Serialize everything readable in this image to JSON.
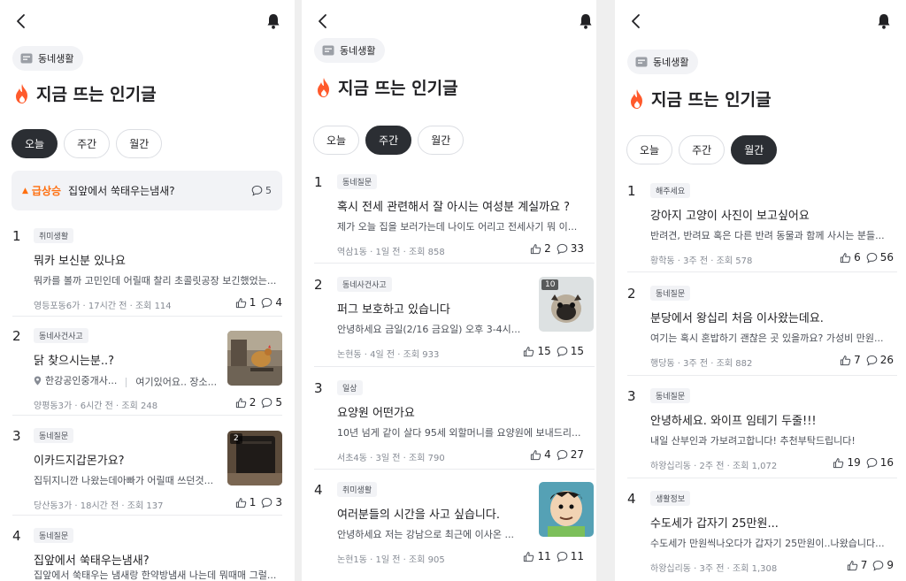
{
  "panels": [
    {
      "chip": "동네생활",
      "title": "지금 뜨는 인기글",
      "tabs": [
        "오늘",
        "주간",
        "월간"
      ],
      "active_tab": "오늘",
      "trending": {
        "label": "급상승",
        "text": "집앞에서 쑥태우는냄새?",
        "comments": "5"
      },
      "posts": [
        {
          "rank": "1",
          "category": "취미생활",
          "title": "뭐카 보신분 있나요",
          "body": "뭐카를 볼까 고민인데 어릴때 찰리 초콜릿공장 보긴했었는...",
          "area": "영등포동6가",
          "time": "17시간 전",
          "views": "조회 114",
          "likes": "1",
          "comments": "4"
        },
        {
          "rank": "2",
          "category": "동네사건사고",
          "title": "닭 찾으시는분..?",
          "location": "한강공인중개사...",
          "body": "여기있어요.. 장소...",
          "area": "양평동3가",
          "time": "6시간 전",
          "views": "조회 248",
          "likes": "2",
          "comments": "5"
        },
        {
          "rank": "3",
          "category": "동네질문",
          "title": "이카드지갑몬가요?",
          "body": "집뒤지니깐 나왔는데아빠가 어릴때 쓰던것...",
          "area": "당산동3가",
          "time": "18시간 전",
          "views": "조회 137",
          "likes": "1",
          "comments": "3",
          "image_count": "2"
        },
        {
          "rank": "4",
          "category": "동네질문",
          "title": "집앞에서 쑥태우는냄새?",
          "body": "집앞에서 쑥태우는 냄새랑 한약방냄새 나는데 뭐때매 그럴..."
        }
      ]
    },
    {
      "chip": "동네생활",
      "title": "지금 뜨는 인기글",
      "tabs": [
        "오늘",
        "주간",
        "월간"
      ],
      "active_tab": "주간",
      "posts": [
        {
          "rank": "1",
          "category": "동네질문",
          "title": "혹시 전세 관련해서 잘 아시는 여성분 계실까요 ?",
          "body": "제가 오늘 집을 보러가는데 나이도 어리고 전세사기 뭐 이...",
          "area": "역삼1동",
          "time": "1일 전",
          "views": "조회 858",
          "likes": "2",
          "comments": "33"
        },
        {
          "rank": "2",
          "category": "동네사건사고",
          "title": "퍼그 보호하고 있습니다",
          "body": "안녕하세요 금일(2/16 금요일) 오후 3-4시...",
          "area": "논현동",
          "time": "4일 전",
          "views": "조회 933",
          "likes": "15",
          "comments": "15",
          "image_count": "10"
        },
        {
          "rank": "3",
          "category": "일상",
          "title": "요양원 어떤가요",
          "body": "10년 넘게 같이 살다 95세 외할머니를 요양원에 보내드리...",
          "area": "서초4동",
          "time": "3일 전",
          "views": "조회 790",
          "likes": "4",
          "comments": "27"
        },
        {
          "rank": "4",
          "category": "취미생활",
          "title": "여러분들의 시간을 사고 싶습니다.",
          "body": "안녕하세요 저는 강남으로 최근에 이사온 ...",
          "area": "논현1동",
          "time": "1일 전",
          "views": "조회 905",
          "likes": "11",
          "comments": "11"
        }
      ]
    },
    {
      "chip": "동네생활",
      "title": "지금 뜨는 인기글",
      "tabs": [
        "오늘",
        "주간",
        "월간"
      ],
      "active_tab": "월간",
      "posts": [
        {
          "rank": "1",
          "category": "해주세요",
          "title": "강아지 고양이 사진이 보고싶어요",
          "body": "반려견, 반려묘 혹은 다른 반려 동물과 함께 사시는 분들...",
          "area": "황학동",
          "time": "3주 전",
          "views": "조회 578",
          "likes": "6",
          "comments": "56"
        },
        {
          "rank": "2",
          "category": "동네질문",
          "title": "분당에서 왕십리 처음 이사왔는데요.",
          "body": "여기는 혹시 혼밥하기 괜찮은 곳 있을까요? 가성비 만원...",
          "area": "행당동",
          "time": "3주 전",
          "views": "조회 882",
          "likes": "7",
          "comments": "26"
        },
        {
          "rank": "3",
          "category": "동네질문",
          "title": "안녕하세요. 와이프 임테기 두줄!!!",
          "body": "내일 산부인과 가보려고합니다! 추천부탁드립니다!",
          "area": "하왕십리동",
          "time": "2주 전",
          "views": "조회 1,072",
          "likes": "19",
          "comments": "16"
        },
        {
          "rank": "4",
          "category": "생활정보",
          "title": "수도세가 갑자기 25만원...",
          "body": "수도세가 만원씩나오다가 갑자기 25만원이..나왔습니다...",
          "area": "하왕십리동",
          "time": "3주 전",
          "views": "조회 1,308",
          "likes": "7",
          "comments": "9"
        }
      ]
    }
  ],
  "colors": {
    "accent": "#ff6f0f",
    "active_tab": "#2b2e33",
    "chip_bg": "#f2f3f6",
    "fire": "#ff5a2c"
  },
  "icons": {
    "back": "chevron-left-icon",
    "bell": "bell-icon",
    "chip": "board-icon",
    "title": "fire-icon",
    "like": "thumb-up-icon",
    "comment": "speech-bubble-icon",
    "location": "location-pin-icon"
  }
}
